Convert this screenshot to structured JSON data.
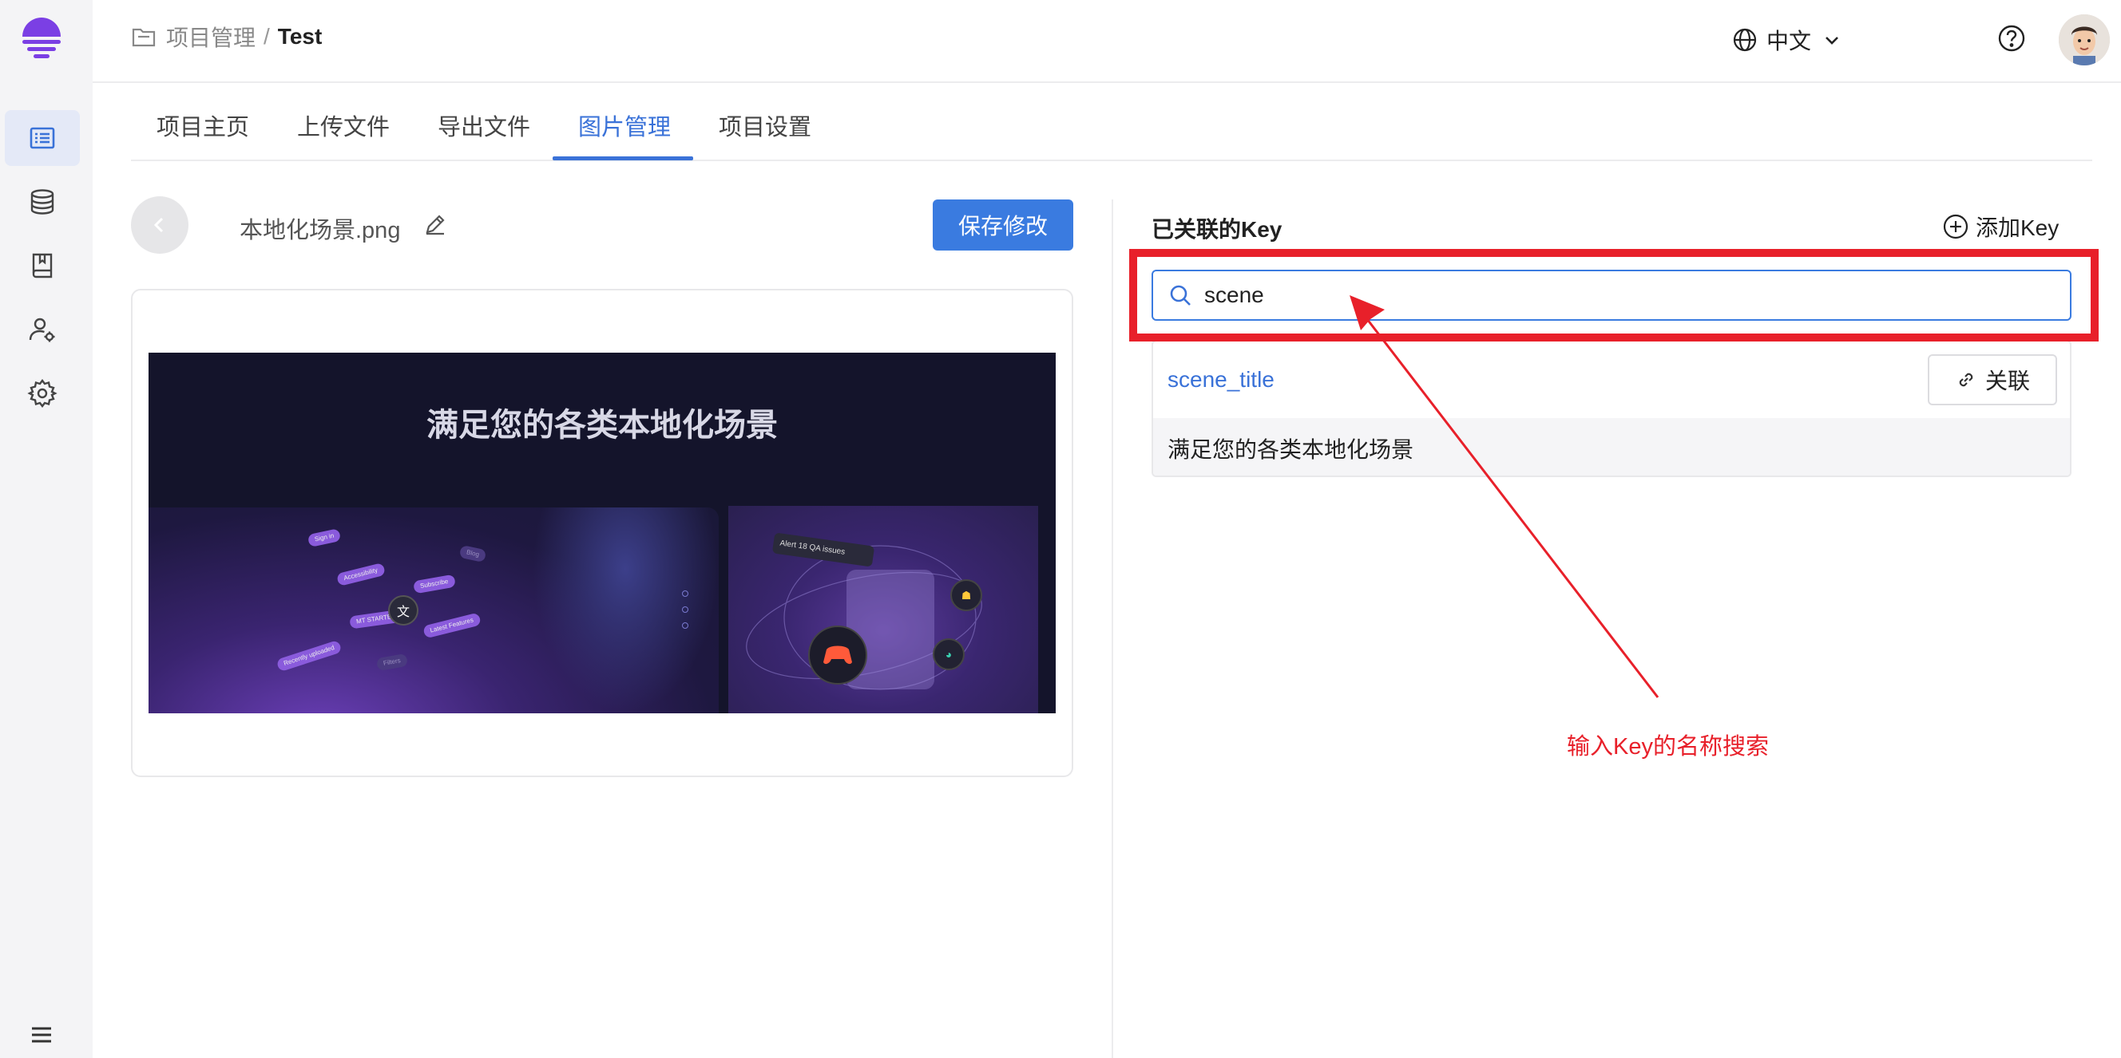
{
  "sidebar": {
    "items": [
      {
        "name": "projects",
        "icon": "list-icon",
        "active": true
      },
      {
        "name": "database",
        "icon": "database-icon",
        "active": false
      },
      {
        "name": "docs",
        "icon": "book-icon",
        "active": false
      },
      {
        "name": "users",
        "icon": "user-settings-icon",
        "active": false
      },
      {
        "name": "settings",
        "icon": "gear-icon",
        "active": false
      }
    ],
    "menu_icon": "menu-icon"
  },
  "header": {
    "breadcrumb": {
      "parent": "项目管理",
      "separator": "/",
      "current": "Test"
    },
    "language": "中文"
  },
  "tabs": [
    {
      "label": "项目主页"
    },
    {
      "label": "上传文件"
    },
    {
      "label": "导出文件"
    },
    {
      "label": "图片管理",
      "active": true
    },
    {
      "label": "项目设置"
    }
  ],
  "image_panel": {
    "filename": "本地化场景.png",
    "save_label": "保存修改",
    "preview_title": "满足您的各类本地化场景",
    "preview_pills": [
      "Sign in",
      "Accessibility",
      "Subscribe",
      "MT STARTED",
      "Latest Features",
      "Recently uploaded",
      "Filters",
      "Blog"
    ],
    "alert_label": "Alert   18 QA issues"
  },
  "keys_panel": {
    "title": "已关联的Key",
    "add_label": "添加Key",
    "search_value": "scene",
    "results": [
      {
        "key": "scene_title",
        "text": "满足您的各类本地化场景",
        "link_label": "关联"
      }
    ]
  },
  "annotation": {
    "text": "输入Key的名称搜索",
    "color": "#e8202a"
  },
  "colors": {
    "accent": "#3a7be0",
    "annotation": "#e8202a"
  }
}
